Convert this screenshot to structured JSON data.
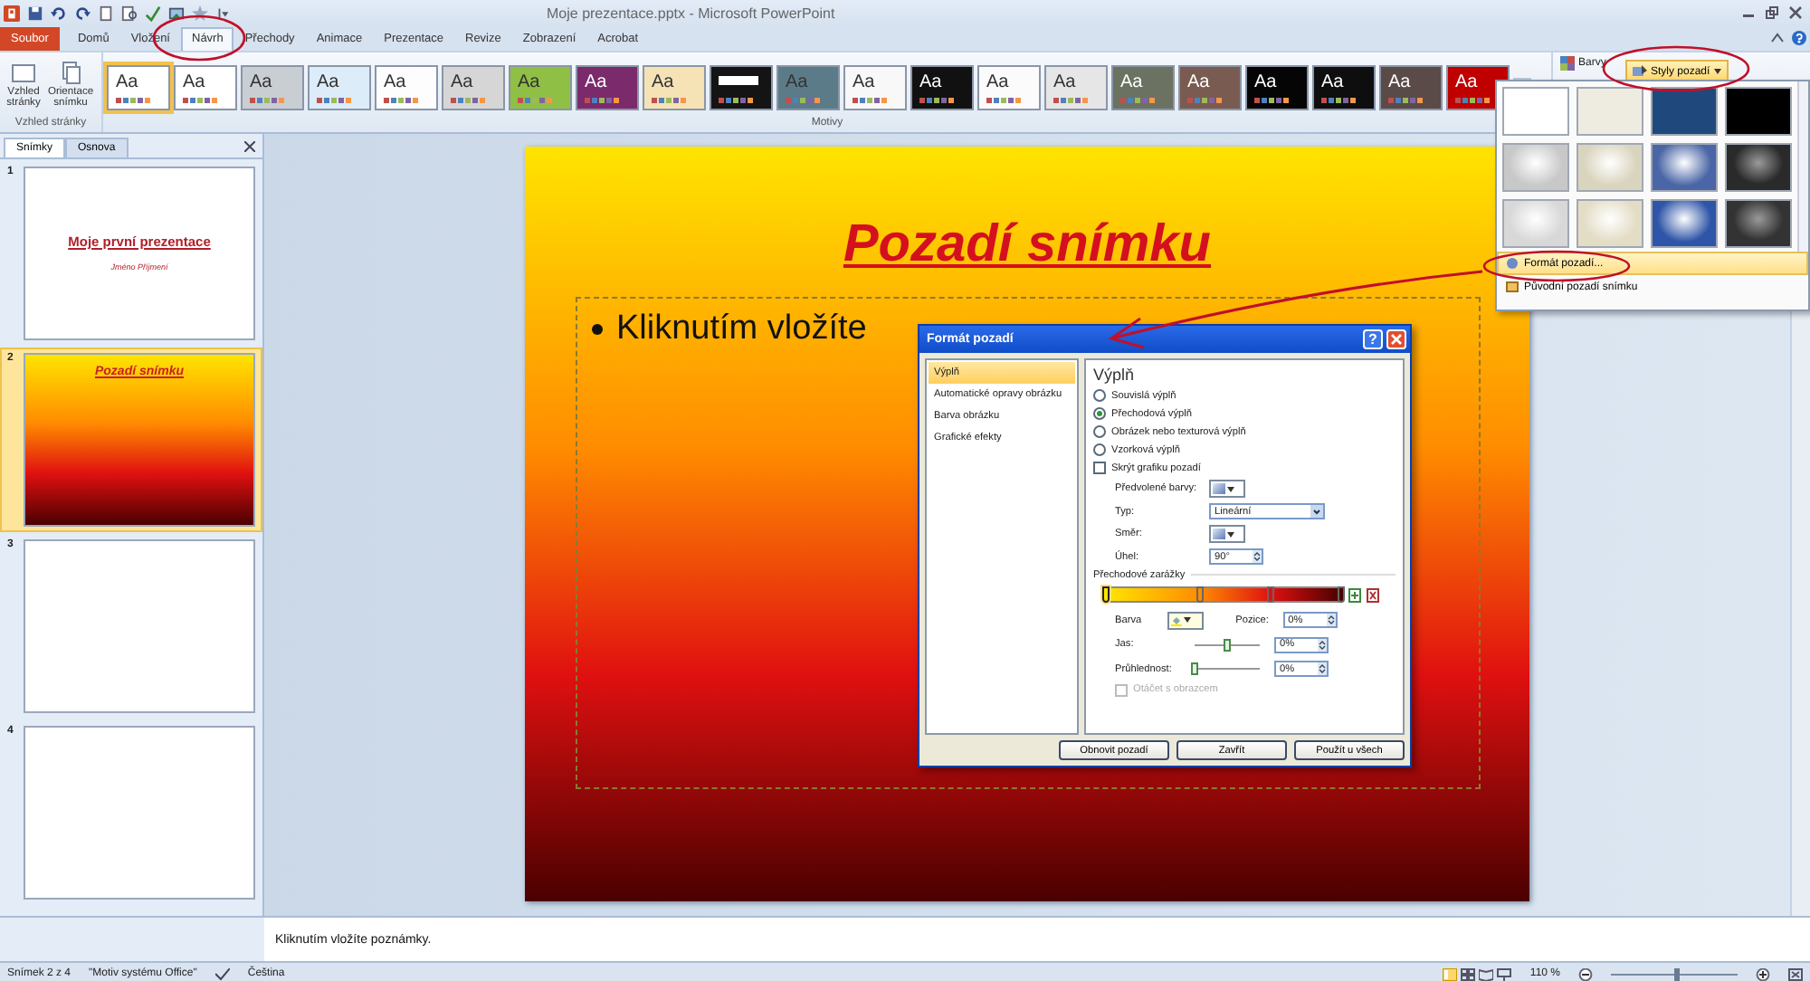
{
  "window": {
    "title": "Moje prezentace.pptx - Microsoft PowerPoint"
  },
  "ribbon_tabs": [
    {
      "label": "Soubor",
      "kind": "file",
      "selected": false
    },
    {
      "label": "Domů",
      "kind": "tab",
      "selected": false
    },
    {
      "label": "Vložení",
      "kind": "tab",
      "selected": false
    },
    {
      "label": "Návrh",
      "kind": "tab",
      "selected": true
    },
    {
      "label": "Přechody",
      "kind": "tab",
      "selected": false
    },
    {
      "label": "Animace",
      "kind": "tab",
      "selected": false
    },
    {
      "label": "Prezentace",
      "kind": "tab",
      "selected": false
    },
    {
      "label": "Revize",
      "kind": "tab",
      "selected": false
    },
    {
      "label": "Zobrazení",
      "kind": "tab",
      "selected": false
    },
    {
      "label": "Acrobat",
      "kind": "tab",
      "selected": false
    }
  ],
  "page_setup": {
    "buttons": [
      "Vzhled stránky",
      "Orientace snímku"
    ],
    "group_label": "Vzhled stránky"
  },
  "themes": {
    "group_label": "Motivy",
    "items": [
      {
        "label": "Aa",
        "color": "#ffffff",
        "selected": true
      },
      {
        "label": "Aa",
        "color": "#ffffff",
        "selected": false
      },
      {
        "label": "Aa",
        "color": "#c9ced3",
        "selected": false
      },
      {
        "label": "Aa",
        "color": "#dcecf8",
        "selected": false
      },
      {
        "label": "Aa",
        "color": "#fdfdfd",
        "selected": false
      },
      {
        "label": "Aa",
        "color": "#d6d6d6",
        "selected": false
      },
      {
        "label": "Aa",
        "color": "#8fbf45",
        "selected": false
      },
      {
        "label": "Aa",
        "color": "#7b2a6c",
        "selected": false
      },
      {
        "label": "Aa",
        "color": "#f5e2b5",
        "selected": false
      },
      {
        "color": "#141414",
        "selected": false
      },
      {
        "label": "Aa",
        "color": "#5b7b88",
        "selected": false
      },
      {
        "label": "Aa",
        "color": "#f8f8f8",
        "selected": false
      },
      {
        "label": "Aa",
        "color": "#111111",
        "selected": false
      },
      {
        "label": "Aa",
        "color": "#fbfbfb",
        "selected": false
      },
      {
        "label": "Aa",
        "color": "#e6e6e6",
        "selected": false
      },
      {
        "label": "Aa",
        "color": "#6b7262",
        "selected": false
      },
      {
        "label": "Aa",
        "color": "#7a5b52",
        "selected": false
      },
      {
        "label": "Aa",
        "color": "#050505",
        "selected": false
      },
      {
        "label": "Aa",
        "color": "#0e0e0e",
        "selected": false
      },
      {
        "label": "Aa",
        "color": "#5a4b49",
        "selected": false
      },
      {
        "label": "Aa",
        "color": "#c00000",
        "selected": false
      }
    ]
  },
  "design_right": {
    "colors_label": "Barvy",
    "background_styles_button": "Styly pozadí"
  },
  "background_styles_menu": {
    "swatches": [
      {
        "color": "#ffffff",
        "kind": "flat"
      },
      {
        "color": "#eeece1",
        "kind": "flat"
      },
      {
        "color": "#1f497d",
        "kind": "flat"
      },
      {
        "color": "#000000",
        "kind": "flat"
      },
      {
        "color": "#c8c8c8",
        "kind": "radial"
      },
      {
        "color": "#d9d4bd",
        "kind": "radial"
      },
      {
        "color": "#4a66a6",
        "kind": "radial"
      },
      {
        "color": "#2a2a2a",
        "kind": "radial"
      },
      {
        "color": "#d8d8d8",
        "kind": "radial"
      },
      {
        "color": "#e3ddc6",
        "kind": "radial"
      },
      {
        "color": "#2f55a8",
        "kind": "radial"
      },
      {
        "color": "#333333",
        "kind": "radial"
      }
    ],
    "items": [
      {
        "label": "Formát pozadí...",
        "selected": true
      },
      {
        "label": "Původní pozadí snímku",
        "selected": false
      }
    ]
  },
  "slides_panel": {
    "tabs": [
      {
        "label": "Snímky",
        "selected": true
      },
      {
        "label": "Osnova",
        "selected": false
      }
    ],
    "slides": [
      {
        "number": "1",
        "kind": "title",
        "selected": false,
        "title": "Moje první prezentace",
        "subtitle": "Jméno Příjmení"
      },
      {
        "number": "2",
        "kind": "gradient",
        "selected": true,
        "title": "Pozadí snímku"
      },
      {
        "number": "3",
        "kind": "blank",
        "selected": false
      },
      {
        "number": "4",
        "kind": "blank",
        "selected": false
      }
    ]
  },
  "slide": {
    "title": "Pozadí snímku",
    "body": "Kliknutím vložíte"
  },
  "notes": {
    "placeholder": "Kliknutím vložíte poznámky."
  },
  "format_dialog": {
    "title": "Formát pozadí",
    "help_label": "?",
    "categories": [
      {
        "label": "Výplň",
        "selected": true
      },
      {
        "label": "Automatické opravy obrázku",
        "selected": false
      },
      {
        "label": "Barva obrázku",
        "selected": false
      },
      {
        "label": "Grafické efekty",
        "selected": false
      }
    ],
    "heading": "Výplň",
    "fill_options": [
      {
        "label": "Souvislá výplň",
        "selected": false
      },
      {
        "label": "Přechodová výplň",
        "selected": true
      },
      {
        "label": "Obrázek nebo texturová výplň",
        "selected": false
      },
      {
        "label": "Vzorková výplň",
        "selected": false
      }
    ],
    "hide_graphics": {
      "label": "Skrýt grafiku pozadí",
      "checked": false
    },
    "preset_label": "Předvolené barvy:",
    "type_label": "Typ:",
    "type_value": "Lineární",
    "direction_label": "Směr:",
    "angle_label": "Úhel:",
    "angle_value": "90°",
    "stops_label": "Přechodové zarážky",
    "stops": [
      {
        "level": 0,
        "color": "#ffe400",
        "selected": true
      },
      {
        "level": 0.4,
        "color": "#ff8c00",
        "selected": false
      },
      {
        "level": 0.7,
        "color": "#e01010",
        "selected": false
      },
      {
        "level": 1,
        "color": "#4a0000",
        "selected": false
      }
    ],
    "color_label": "Barva",
    "position_label": "Pozice:",
    "position_value": "0%",
    "brightness": {
      "label": "Jas:",
      "level": 0.5,
      "value": "0%"
    },
    "transparency": {
      "label": "Průhlednost:",
      "level": 0,
      "value": "0%"
    },
    "rotate": {
      "label": "Otáčet s obrazcem",
      "checked": false,
      "disabled": true
    },
    "buttons": [
      "Obnovit pozadí",
      "Zavřít",
      "Použít u všech"
    ]
  },
  "status_bar": {
    "slide": "Snímek 2 z 4",
    "theme": "\"Motiv systému Office\"",
    "language": "Čeština",
    "zoom": "110 %",
    "level": 0.5
  }
}
